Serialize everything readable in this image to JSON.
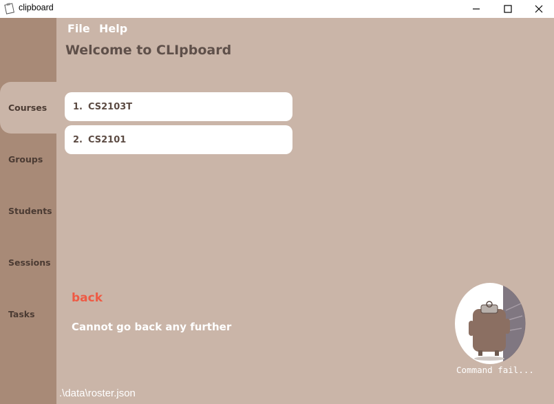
{
  "window": {
    "title": "clipboard",
    "icons": {
      "app": "clipboard-app-icon",
      "minimize": "minimize-icon",
      "maximize": "maximize-icon",
      "close": "close-icon"
    }
  },
  "menu": {
    "file": "File",
    "help": "Help"
  },
  "header": {
    "title": "Welcome to CLIpboard"
  },
  "sidebar": {
    "tabs": [
      {
        "label": "Courses",
        "active": true
      },
      {
        "label": "Groups",
        "active": false
      },
      {
        "label": "Students",
        "active": false
      },
      {
        "label": "Sessions",
        "active": false
      },
      {
        "label": "Tasks",
        "active": false
      }
    ]
  },
  "courses": [
    {
      "index": "1.",
      "code": "CS2103T"
    },
    {
      "index": "2.",
      "code": "CS2101"
    }
  ],
  "command": {
    "last_input": "back",
    "result": "Cannot go back any further"
  },
  "mascot": {
    "caption": "Command fail...",
    "icon": "clipboard-mascot-icon"
  },
  "status": {
    "path": ".\\data\\roster.json"
  },
  "colors": {
    "sidebar": "#a88a77",
    "content": "#cab5a8",
    "card": "#ffffff",
    "command": "#ee5a44",
    "title": "#5f504a"
  }
}
